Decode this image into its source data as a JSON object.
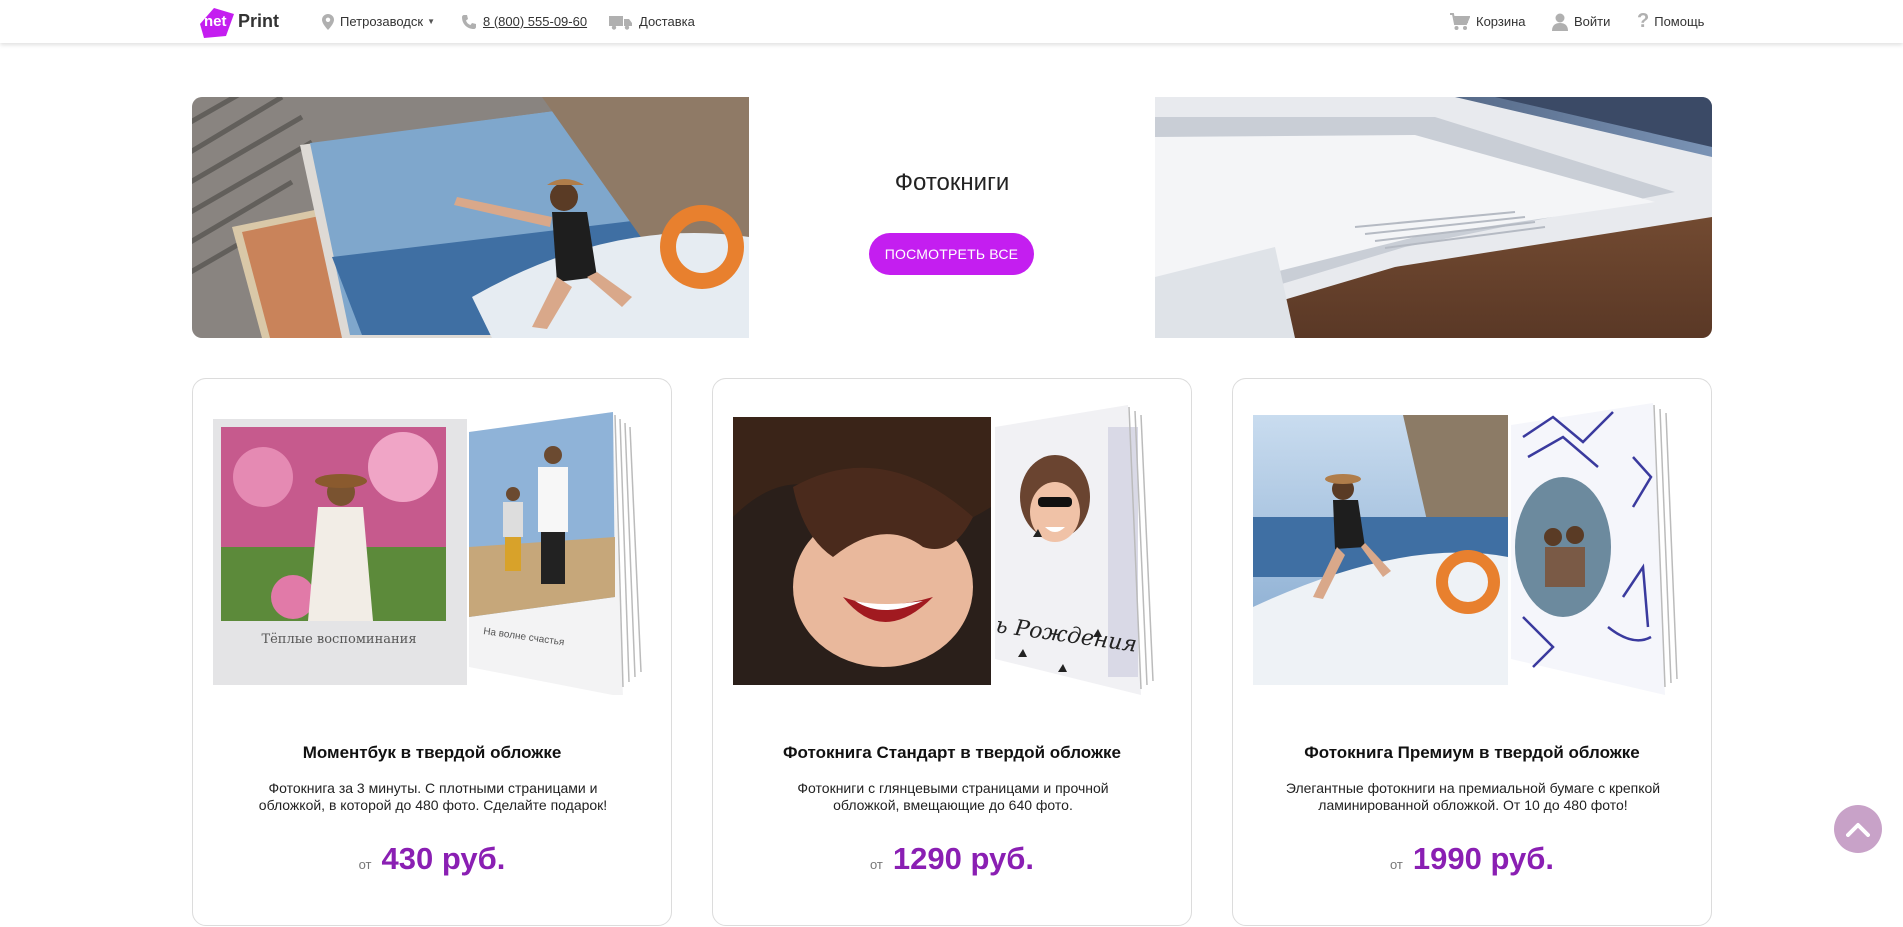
{
  "header": {
    "logo_net": "net",
    "logo_print": "Print",
    "city": "Петрозаводск",
    "phone": "8 (800) 555-09-60",
    "delivery": "Доставка",
    "cart": "Корзина",
    "login": "Войти",
    "help": "Помощь"
  },
  "banner": {
    "title": "Фотокниги",
    "button_label": "ПОСМОТРЕТЬ ВСЕ"
  },
  "products": [
    {
      "title": "Моментбук в твердой обложке",
      "description": "Фотокнига за 3 минуты. С плотными страницами и обложкой, в которой до 480 фото. Сделайте подарок!",
      "price_prefix": "от",
      "price": "430 руб.",
      "cover_caption": "Тёплые воспоминания",
      "page_caption": "На волне счастья"
    },
    {
      "title": "Фотокнига Стандарт в твердой обложке",
      "description": "Фотокниги с глянцевыми страницами и прочной обложкой, вмещающие до 640 фото.",
      "price_prefix": "от",
      "price": "1290 руб.",
      "page_caption": "ь Рождения"
    },
    {
      "title": "Фотокнига Премиум в твердой обложке",
      "description": "Элегантные фотокниги на премиальной бумаге с крепкой ламинированной обложкой. От 10 до 480 фото!",
      "price_prefix": "от",
      "price": "1990 руб."
    }
  ],
  "colors": {
    "accent": "#c41ef0",
    "price": "#8a1fb3",
    "scroll_button": "#c8a2c8"
  }
}
